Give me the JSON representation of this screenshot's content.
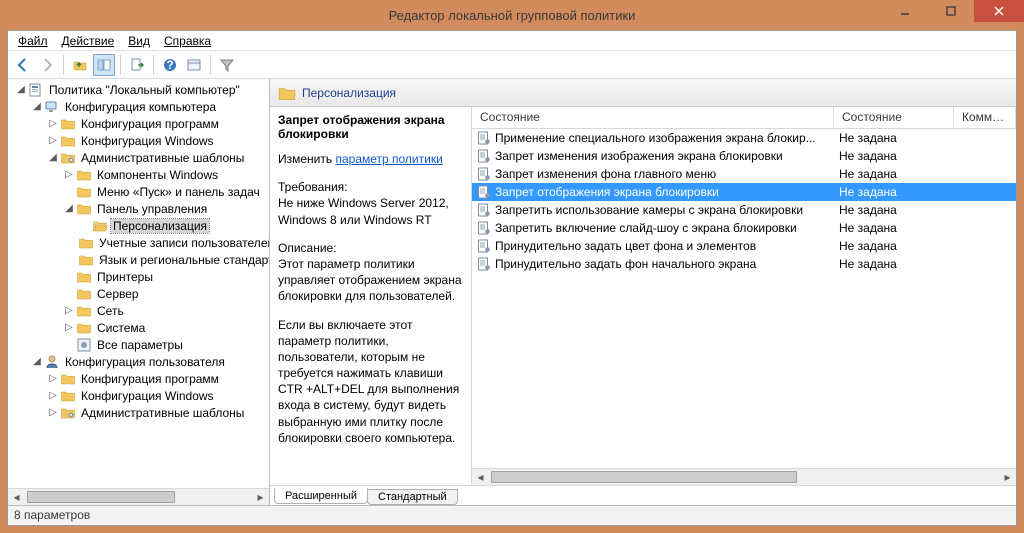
{
  "window": {
    "title": "Редактор локальной групповой политики"
  },
  "menu": {
    "file": "Файл",
    "action": "Действие",
    "view": "Вид",
    "help": "Справка"
  },
  "tree": {
    "root": "Политика \"Локальный компьютер\"",
    "comp_config": "Конфигурация компьютера",
    "cfg_programs": "Конфигурация программ",
    "cfg_windows": "Конфигурация Windows",
    "admin_templates": "Административные шаблоны",
    "components_win": "Компоненты Windows",
    "start_taskbar": "Меню «Пуск» и панель задач",
    "control_panel": "Панель управления",
    "personalization": "Персонализация",
    "user_accounts": "Учетные записи пользователей",
    "lang_regional": "Язык и региональные стандарты",
    "printers": "Принтеры",
    "server": "Сервер",
    "network": "Сеть",
    "system": "Система",
    "all_params": "Все параметры",
    "user_config": "Конфигурация пользователя",
    "u_cfg_programs": "Конфигурация программ",
    "u_cfg_windows": "Конфигурация Windows",
    "u_admin_templates": "Административные шаблоны"
  },
  "content": {
    "heading": "Персонализация",
    "detail_title": "Запрет отображения экрана блокировки",
    "edit_prefix": "Изменить ",
    "edit_link": "параметр политики",
    "req_label": "Требования:",
    "req_text": "Не ниже Windows Server 2012, Windows 8 или Windows RT",
    "desc_label": "Описание:",
    "desc_text1": "Этот параметр политики управляет отображением экрана блокировки для пользователей.",
    "desc_text2": "Если вы включаете этот параметр политики, пользователи, которым не требуется нажимать клавиши CTR +ALT+DEL для выполнения входа в систему, будут видеть выбранную ими плитку после блокировки своего компьютера."
  },
  "columns": {
    "c1": "Состояние",
    "c2": "Состояние",
    "c3": "Комментарий"
  },
  "list": [
    {
      "name": "Применение специального изображения экрана блокир...",
      "state": "Не задана"
    },
    {
      "name": "Запрет изменения изображения экрана блокировки",
      "state": "Не задана"
    },
    {
      "name": "Запрет изменения фона главного меню",
      "state": "Не задана"
    },
    {
      "name": "Запрет отображения экрана блокировки",
      "state": "Не задана",
      "selected": true
    },
    {
      "name": "Запретить использование камеры с экрана блокировки",
      "state": "Не задана"
    },
    {
      "name": "Запретить включение слайд-шоу с экрана блокировки",
      "state": "Не задана"
    },
    {
      "name": "Принудительно задать цвет фона и элементов",
      "state": "Не задана"
    },
    {
      "name": "Принудительно задать фон начального экрана",
      "state": "Не задана"
    }
  ],
  "tabs": {
    "extended": "Расширенный",
    "standard": "Стандартный"
  },
  "status": "8 параметров"
}
